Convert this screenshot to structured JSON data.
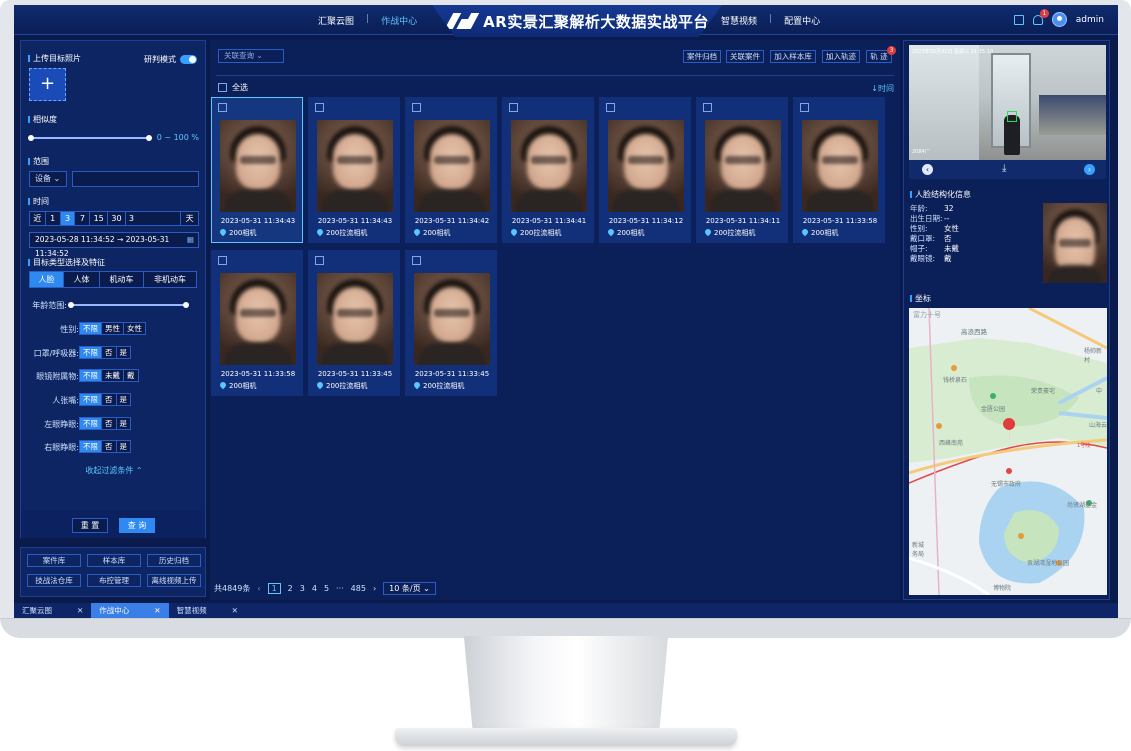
{
  "header": {
    "title": "AR实景汇聚解析大数据实战平台",
    "nav_left": [
      "汇聚云图",
      "作战中心"
    ],
    "nav_right": [
      "智慧视频",
      "配置中心"
    ],
    "notify_count": "1",
    "username": "admin"
  },
  "left": {
    "upload_title": "上传目标照片",
    "upload_plus": "+",
    "mode_label": "研判模式",
    "similarity_title": "相似度",
    "similarity_range": "0 ~ 100 %",
    "similarity_min": 0,
    "similarity_max": 100,
    "scope_title": "范围",
    "scope_select": "设备 ⌄",
    "time_title": "时间",
    "time_quick": [
      "近",
      "1",
      "3",
      "7",
      "15",
      "30",
      "3",
      "天"
    ],
    "time_range": "2023-05-28 11:34:52 → 2023-05-31 11:34:52",
    "target_title": "目标类型选择及特征",
    "target_types": [
      "人脸",
      "人体",
      "机动车",
      "非机动车"
    ],
    "age_label": "年龄范围:",
    "gender_label": "性别:",
    "gender_opts": [
      "不限",
      "男性",
      "女性"
    ],
    "mask_label": "口罩/呼吸器:",
    "mask_opts": [
      "不限",
      "否",
      "是"
    ],
    "eyewear_label": "眼镜附属物:",
    "eyewear_opts": [
      "不限",
      "未戴",
      "戴"
    ],
    "mouth_label": "人张嘴:",
    "mouth_opts": [
      "不限",
      "否",
      "是"
    ],
    "left_eye_label": "左眼睁眼:",
    "left_eye_opts": [
      "不限",
      "否",
      "是"
    ],
    "right_eye_label": "右眼睁眼:",
    "right_eye_opts": [
      "不限",
      "否",
      "是"
    ],
    "collapse": "收起过滤条件 ⌃",
    "reset": "重 置",
    "query": "查 询",
    "links": [
      "案件库",
      "样本库",
      "历史归档",
      "技战法仓库",
      "布控管理",
      "离线视频上传"
    ]
  },
  "middle": {
    "assoc_select": "关联查询      ⌄",
    "actions": [
      "案件归档",
      "关联案件",
      "加入样本库",
      "加入轨迹",
      "轨 迹"
    ],
    "track_badge": "3",
    "select_all": "全选",
    "sort": "↓时间",
    "results": [
      {
        "time": "2023-05-31 11:34:43",
        "camera": "200相机"
      },
      {
        "time": "2023-05-31 11:34:43",
        "camera": "200拉流相机"
      },
      {
        "time": "2023-05-31 11:34:42",
        "camera": "200相机"
      },
      {
        "time": "2023-05-31 11:34:41",
        "camera": "200拉流相机"
      },
      {
        "time": "2023-05-31 11:34:12",
        "camera": "200相机"
      },
      {
        "time": "2023-05-31 11:34:11",
        "camera": "200拉流相机"
      },
      {
        "time": "2023-05-31 11:33:58",
        "camera": "200相机"
      },
      {
        "time": "2023-05-31 11:33:58",
        "camera": "200相机"
      },
      {
        "time": "2023-05-31 11:33:45",
        "camera": "200拉流相机"
      },
      {
        "time": "2023-05-31 11:33:45",
        "camera": "200拉流相机"
      }
    ],
    "total": "共4849条",
    "pages": [
      "‹",
      "1",
      "2",
      "3",
      "4",
      "5",
      "···",
      "485",
      "›"
    ],
    "page_size": "10 条/页 ⌄"
  },
  "right": {
    "scene_stamp": "2023年05月31日  星期三  11:35:10",
    "scene_tag": "2084厂",
    "face_title": "人脸结构化信息",
    "attrs": [
      {
        "k": "年龄:",
        "v": "32"
      },
      {
        "k": "出生日期:",
        "v": "--"
      },
      {
        "k": "性别:",
        "v": "女性"
      },
      {
        "k": "戴口罩:",
        "v": "否"
      },
      {
        "k": "帽子:",
        "v": "未戴"
      },
      {
        "k": "戴眼镜:",
        "v": "戴"
      }
    ],
    "coord_title": "坐标",
    "map_labels": [
      "富力十号",
      "高浪西路",
      "杨帅新村",
      "钱桥泉石",
      "中",
      "荣贵豪宅",
      "金匮公园",
      "山海云",
      "西峰南苑",
      "1号线",
      "无锡市政府",
      "尚贤湖基金",
      "新城",
      "务局",
      "贡湖湾湿地公园",
      "博物院"
    ]
  },
  "tabs": [
    {
      "label": "汇聚云图",
      "close": "✕"
    },
    {
      "label": "作战中心",
      "close": "✕"
    },
    {
      "label": "智慧视频",
      "close": "✕"
    }
  ],
  "colors": {
    "accent": "#2e8af0",
    "highlight": "#5cc6ff",
    "bg": "#0a1a4a"
  }
}
